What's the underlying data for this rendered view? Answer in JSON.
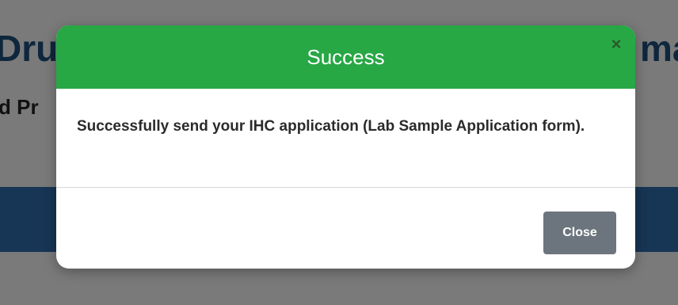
{
  "background": {
    "title_left": "Dru",
    "title_right": "ma",
    "subtitle": "d Pr"
  },
  "modal": {
    "title": "Success",
    "close_icon": "close-icon",
    "close_glyph": "×",
    "message": "Successfully send your IHC application (Lab Sample Application form).",
    "close_button_label": "Close"
  },
  "colors": {
    "header": "#28a745",
    "close_button": "#6c757d",
    "background_bar": "#2e6aa8"
  }
}
